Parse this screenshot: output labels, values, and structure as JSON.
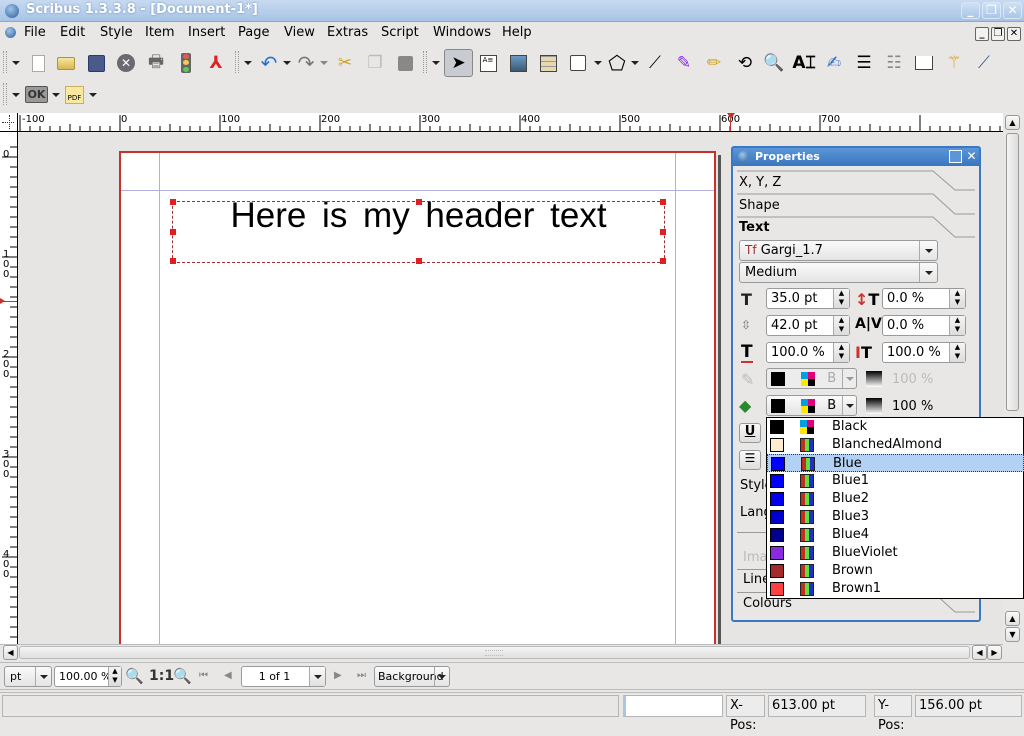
{
  "window": {
    "title": "Scribus 1.3.3.8 - [Document-1*]"
  },
  "menubar": {
    "items": [
      "File",
      "Edit",
      "Style",
      "Item",
      "Insert",
      "Page",
      "View",
      "Extras",
      "Script",
      "Windows",
      "Help"
    ]
  },
  "toolbar2": {
    "ok_label": "OK",
    "pdf_label": "PDF"
  },
  "ruler": {
    "h_labels": [
      "-100",
      "0",
      "100",
      "200",
      "300",
      "400",
      "500",
      "600",
      "700",
      "800"
    ],
    "v_labels": [
      "0",
      "100",
      "200",
      "300",
      "400"
    ]
  },
  "canvas": {
    "text_frame_content": "Here is my header text"
  },
  "properties": {
    "title": "Properties",
    "sections": {
      "xyz": "X, Y, Z",
      "shape": "Shape",
      "text": "Text",
      "image": "Image",
      "line": "Line",
      "colours": "Colours"
    },
    "font_family": "Gargi_1.7",
    "font_style": "Medium",
    "font_size": "35.0 pt",
    "line_spacing": "42.0 pt",
    "scale_width": "100.0 %",
    "baseline_offset": "0.0 %",
    "tracking": "0.0 %",
    "scale_height": "100.0 %",
    "stroke_color_label": "B",
    "stroke_shade": "100 %",
    "fill_color_label": "B",
    "fill_shade": "100 %",
    "style_label": "Style",
    "language_label": "Lang"
  },
  "color_dropdown": {
    "selected": "Blue",
    "options": [
      {
        "name": "Black",
        "swatch": "#000000",
        "model": "cmyk"
      },
      {
        "name": "BlanchedAlmond",
        "swatch": "#ffebcd",
        "model": "rgb"
      },
      {
        "name": "Blue",
        "swatch": "#0000ff",
        "model": "rgb"
      },
      {
        "name": "Blue1",
        "swatch": "#0000ff",
        "model": "rgb"
      },
      {
        "name": "Blue2",
        "swatch": "#0000ee",
        "model": "rgb"
      },
      {
        "name": "Blue3",
        "swatch": "#0000cd",
        "model": "rgb"
      },
      {
        "name": "Blue4",
        "swatch": "#00008b",
        "model": "rgb"
      },
      {
        "name": "BlueViolet",
        "swatch": "#8a2be2",
        "model": "rgb"
      },
      {
        "name": "Brown",
        "swatch": "#a52a2a",
        "model": "rgb"
      },
      {
        "name": "Brown1",
        "swatch": "#ff4040",
        "model": "rgb"
      }
    ]
  },
  "bottombar": {
    "unit": "pt",
    "zoom": "100.00 %",
    "zoom_1to1": "1:1",
    "page": "1 of 1",
    "layer": "Background"
  },
  "statusbar": {
    "xpos_label": "X-Pos:",
    "xpos_value": "613.00 pt",
    "ypos_label": "Y-Pos:",
    "ypos_value": "156.00 pt"
  }
}
